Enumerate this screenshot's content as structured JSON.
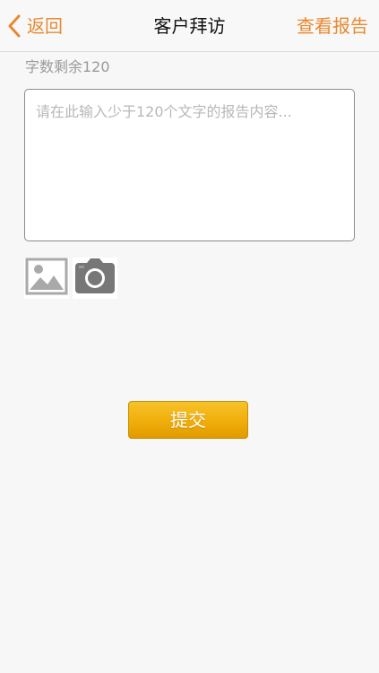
{
  "navbar": {
    "back_label": "返回",
    "title": "客户拜访",
    "right_action": "查看报告",
    "accent_color": "#e8892f"
  },
  "report": {
    "counter_text": "字数剩余120",
    "input_value": "",
    "placeholder": "请在此输入少于120个文字的报告内容..."
  },
  "media": {
    "gallery_icon": "image-gallery-icon",
    "camera_icon": "camera-icon"
  },
  "submit": {
    "label": "提交",
    "color": "#f0ae0a"
  }
}
